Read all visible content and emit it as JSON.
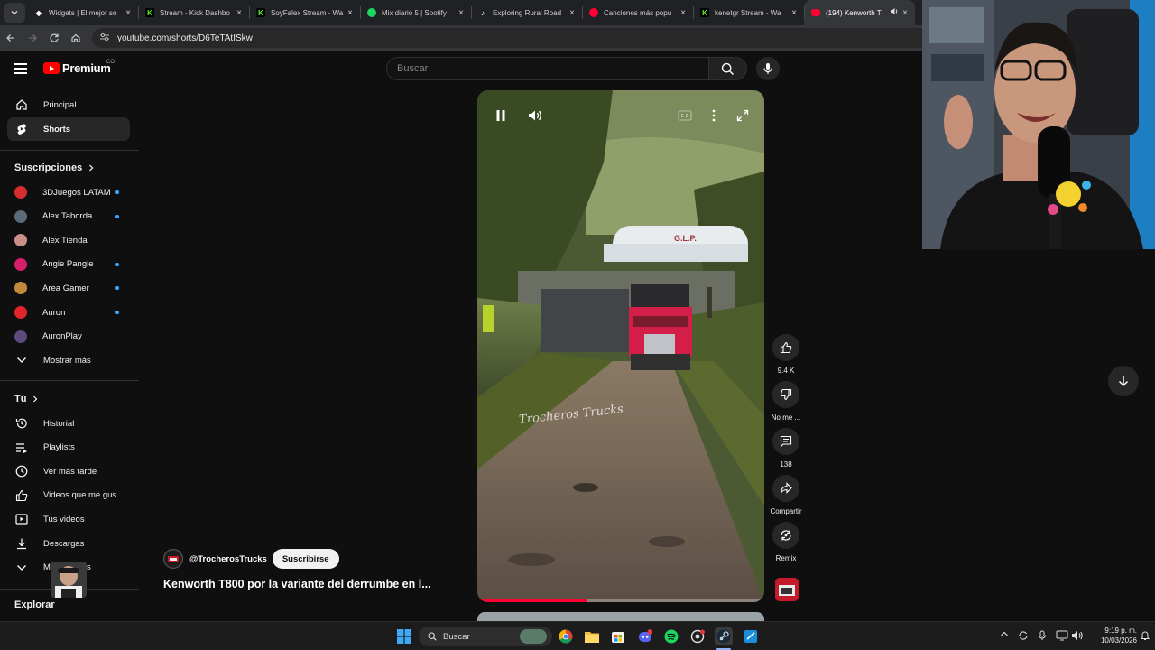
{
  "browser": {
    "tabs": [
      {
        "label": "Widgets | El mejor so",
        "icon": "diamond-icon",
        "color": "#ffffff"
      },
      {
        "label": "Stream - Kick Dashbo",
        "icon": "kick-icon",
        "color": "#53fc18"
      },
      {
        "label": "SoyFalex Stream - Wa",
        "icon": "kick-icon",
        "color": "#53fc18"
      },
      {
        "label": "Mix diario 5 | Spotify",
        "icon": "spotify-icon",
        "color": "#1ed760"
      },
      {
        "label": "Exploring Rural Road",
        "icon": "tiktok-icon",
        "color": "#ffffff"
      },
      {
        "label": "Canciones más popu",
        "icon": "youtube-music-icon",
        "color": "#ff0033"
      },
      {
        "label": "kenetgr Stream - Wa",
        "icon": "kick-icon",
        "color": "#53fc18"
      },
      {
        "label": "(194) Kenworth T",
        "icon": "youtube-icon",
        "color": "#ff0033",
        "active": true
      }
    ],
    "url": "youtube.com/shorts/D6TeTAtISkw"
  },
  "masthead": {
    "logo_text": "Premium",
    "country_code": "CO",
    "search_placeholder": "Buscar"
  },
  "sidebar": {
    "main": [
      {
        "label": "Principal",
        "icon": "home-icon"
      },
      {
        "label": "Shorts",
        "icon": "shorts-icon",
        "active": true
      }
    ],
    "subscriptions_title": "Suscripciones",
    "subscriptions": [
      {
        "label": "3DJuegos LATAM",
        "color": "#d62e2e",
        "live": true
      },
      {
        "label": "Alex Taborda",
        "color": "#5a6b7a",
        "live": true
      },
      {
        "label": "Alex Tienda",
        "color": "#c98f86",
        "live": false
      },
      {
        "label": "Angie Pangie",
        "color": "#d61f6a",
        "live": true
      },
      {
        "label": "Area Gamer",
        "color": "#c08a3a",
        "live": true
      },
      {
        "label": "Auron",
        "color": "#e0262b",
        "live": true
      },
      {
        "label": "AuronPlay",
        "color": "#5b4a7a",
        "live": false
      }
    ],
    "show_more": "Mostrar más",
    "you_title": "Tú",
    "you_items": [
      {
        "label": "Historial",
        "icon": "history-icon"
      },
      {
        "label": "Playlists",
        "icon": "playlists-icon"
      },
      {
        "label": "Ver más tarde",
        "icon": "watch-later-icon"
      },
      {
        "label": "Videos que me gus...",
        "icon": "liked-icon"
      },
      {
        "label": "Tus videos",
        "icon": "your-videos-icon"
      },
      {
        "label": "Descargas",
        "icon": "download-icon"
      },
      {
        "label": "Mostrar más",
        "icon": "chevron-down-icon"
      }
    ],
    "explore_title": "Explorar"
  },
  "short": {
    "watermark": "Trocheros Trucks",
    "channel": "@TrocherosTrucks",
    "subscribe_label": "Suscribirse",
    "title": "Kenworth T800 por la variante del derrumbe en l...",
    "progress": 0.38,
    "truck_text": "G.L.P.",
    "actions": [
      {
        "label": "9.4 K",
        "icon": "like-icon"
      },
      {
        "label": "No me ...",
        "icon": "dislike-icon"
      },
      {
        "label": "138",
        "icon": "comment-icon"
      },
      {
        "label": "Compartir",
        "icon": "share-icon"
      },
      {
        "label": "Remix",
        "icon": "remix-icon"
      }
    ]
  },
  "taskbar": {
    "search_placeholder": "Buscar",
    "time": "9:19 p. m.",
    "date": "10/03/2026"
  }
}
